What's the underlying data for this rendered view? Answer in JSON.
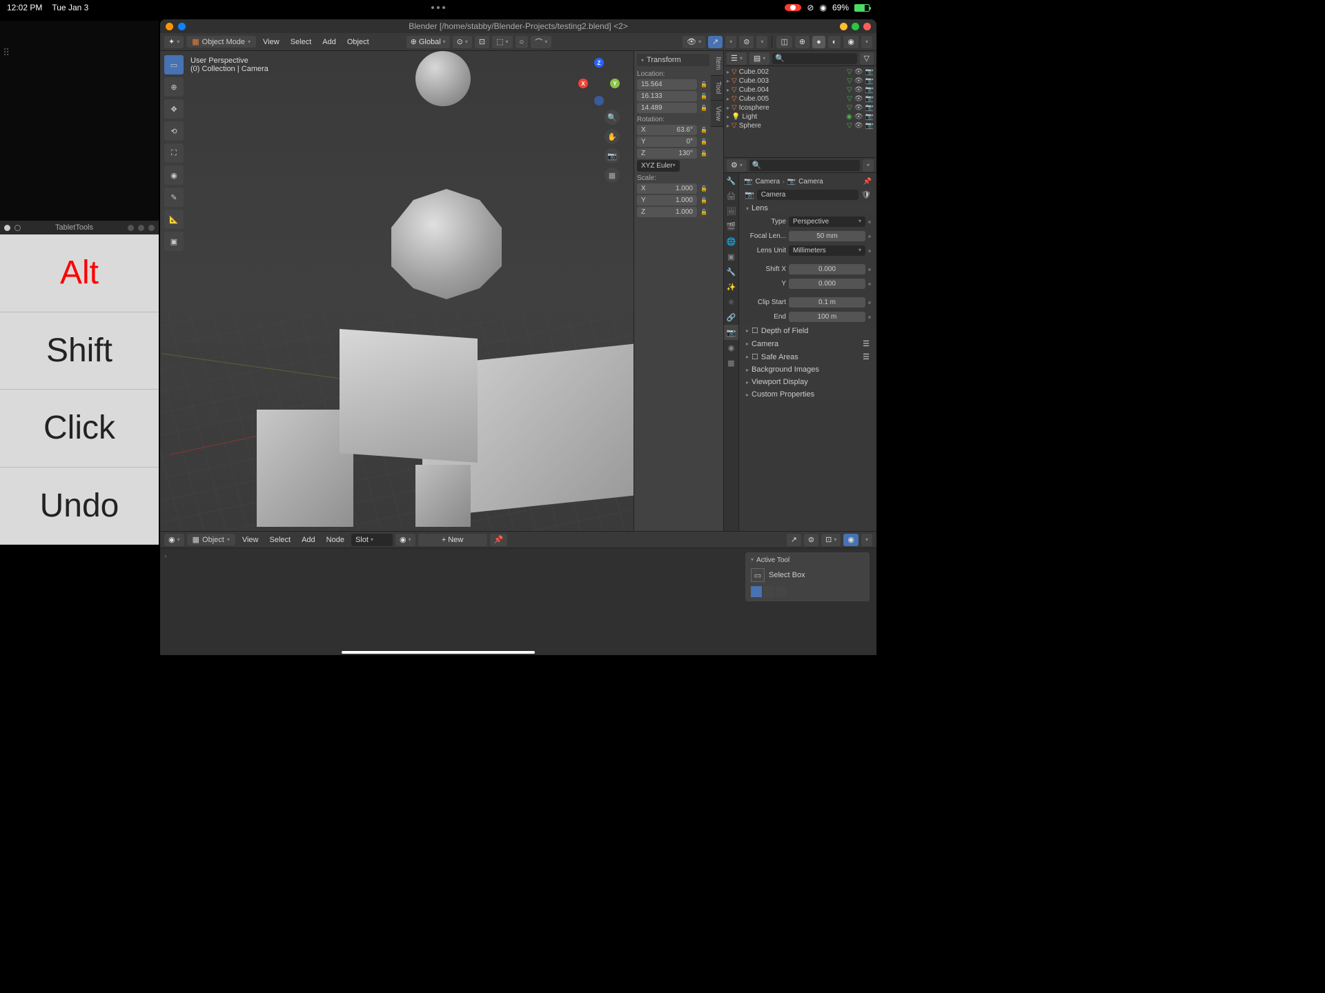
{
  "menubar": {
    "time": "12:02 PM",
    "date": "Tue Jan 3",
    "battery": "69%"
  },
  "tablet": {
    "title": "TabletTools",
    "keys": [
      "Alt",
      "Shift",
      "Click",
      "Undo"
    ]
  },
  "window": {
    "title": "Blender [/home/stabby/Blender-Projects/testing2.blend] <2>"
  },
  "header": {
    "mode": "Object Mode",
    "menus": [
      "View",
      "Select",
      "Add",
      "Object"
    ],
    "orientation": "Global"
  },
  "viewport": {
    "info_line1": "User Perspective",
    "info_line2": "(0) Collection | Camera"
  },
  "npanel": {
    "tabs": [
      "Item",
      "Tool",
      "View"
    ],
    "transform_hdr": "Transform",
    "location_lbl": "Location:",
    "loc_x": "15.564",
    "loc_y": "16.133",
    "loc_z": "14.489",
    "rotation_lbl": "Rotation:",
    "rot_x": "63.6°",
    "rot_y": "0°",
    "rot_z": "130°",
    "rot_mode": "XYZ Euler",
    "scale_lbl": "Scale:",
    "scale_x": "1.000",
    "scale_y": "1.000",
    "scale_z": "1.000"
  },
  "outliner": {
    "items": [
      {
        "name": "Cube.002",
        "icon": "mesh"
      },
      {
        "name": "Cube.003",
        "icon": "mesh"
      },
      {
        "name": "Cube.004",
        "icon": "mesh"
      },
      {
        "name": "Cube.005",
        "icon": "mesh"
      },
      {
        "name": "Icosphere",
        "icon": "mesh"
      },
      {
        "name": "Light",
        "icon": "light"
      },
      {
        "name": "Sphere",
        "icon": "mesh"
      }
    ]
  },
  "props": {
    "breadcrumb": [
      "Camera",
      "Camera"
    ],
    "name_field": "Camera",
    "lens_hdr": "Lens",
    "type_lbl": "Type",
    "type_val": "Perspective",
    "focal_lbl": "Focal Len...",
    "focal_val": "50 mm",
    "unit_lbl": "Lens Unit",
    "unit_val": "Millimeters",
    "shiftx_lbl": "Shift X",
    "shiftx_val": "0.000",
    "shifty_lbl": "Y",
    "shifty_val": "0.000",
    "clipstart_lbl": "Clip Start",
    "clipstart_val": "0.1 m",
    "clipend_lbl": "End",
    "clipend_val": "100 m",
    "panels": [
      "Depth of Field",
      "Camera",
      "Safe Areas",
      "Background Images",
      "Viewport Display",
      "Custom Properties"
    ]
  },
  "shader": {
    "mode": "Object",
    "menus": [
      "View",
      "Select",
      "Add",
      "Node"
    ],
    "slot": "Slot",
    "new": "New",
    "active_tool_hdr": "Active Tool",
    "active_tool": "Select Box"
  }
}
